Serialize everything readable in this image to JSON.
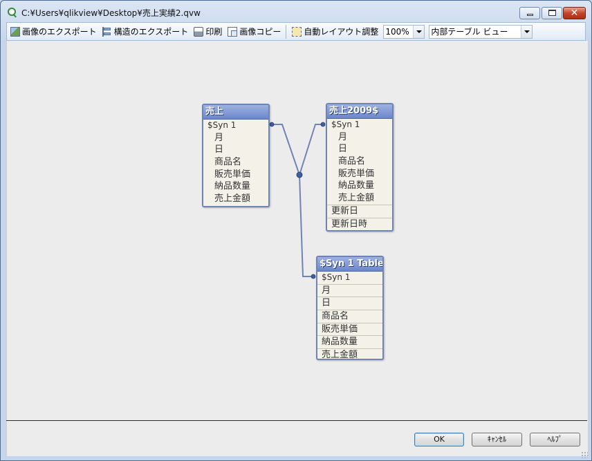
{
  "window": {
    "title": "C:¥Users¥qlikview¥Desktop¥売上実績2.qvw",
    "close_glyph": "✕"
  },
  "toolbar": {
    "export_image_label": "画像のエクスポート",
    "export_structure_label": "構造のエクスポート",
    "print_label": "印刷",
    "copy_image_label": "画像コピー",
    "auto_layout_label": "自動レイアウト調整",
    "zoom_value": "100%",
    "view_value": "内部テーブル ビュー"
  },
  "tables": [
    {
      "name": "売上",
      "fields": [
        "$Syn 1",
        "月",
        "日",
        "商品名",
        "販売単価",
        "納品数量",
        "売上金額"
      ]
    },
    {
      "name": "売上2009$",
      "fields": [
        "$Syn 1",
        "月",
        "日",
        "商品名",
        "販売単価",
        "納品数量",
        "売上金額",
        "更新日",
        "更新日時"
      ]
    },
    {
      "name": "$Syn 1 Table",
      "fields": [
        "$Syn 1",
        "月",
        "日",
        "商品名",
        "販売単価",
        "納品数量",
        "売上金額"
      ]
    }
  ],
  "buttons": {
    "ok": "OK",
    "cancel": "ｷｬﾝｾﾙ",
    "help": "ﾍﾙﾌﾟ"
  },
  "colors": {
    "table_header": "#7a92d2",
    "table_body": "#f3f1e8",
    "link_line": "#6e84b4",
    "link_node": "#3f5f9f"
  }
}
